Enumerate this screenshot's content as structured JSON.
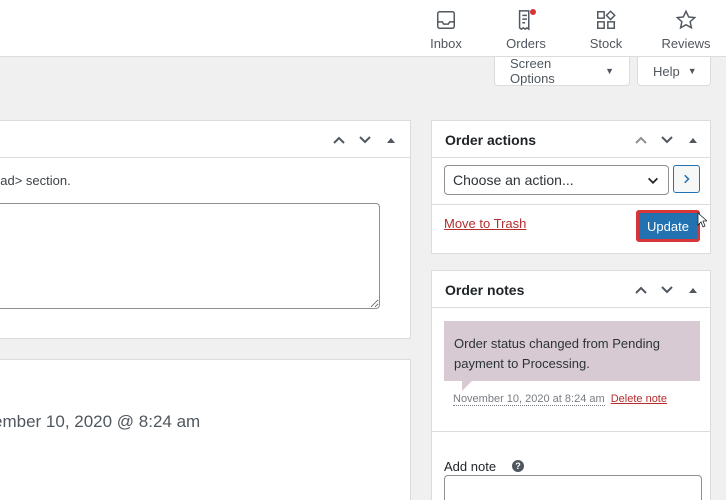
{
  "topnav": [
    {
      "label": "Inbox",
      "icon": "inbox-icon"
    },
    {
      "label": "Orders",
      "icon": "orders-icon"
    },
    {
      "label": "Stock",
      "icon": "stock-icon"
    },
    {
      "label": "Reviews",
      "icon": "reviews-icon"
    }
  ],
  "tabs": {
    "screen_options": "Screen Options",
    "help": "Help"
  },
  "left_panel": {
    "description": "ead> section.",
    "date_text": "ember 10, 2020 @ 8:24 am"
  },
  "order_actions": {
    "title": "Order actions",
    "select_value": "Choose an action...",
    "trash_label": "Move to Trash",
    "update_label": "Update"
  },
  "order_notes": {
    "title": "Order notes",
    "note_text": "Order status changed from Pending payment to Processing.",
    "note_time": "November 10, 2020 at 8:24 am",
    "delete_label": "Delete note",
    "add_note_label": "Add note",
    "help_symbol": "?"
  },
  "colors": {
    "accent": "#2271b1",
    "highlight": "#d63638",
    "note_bg": "#d7cad2",
    "danger_link": "#b32d2e"
  }
}
